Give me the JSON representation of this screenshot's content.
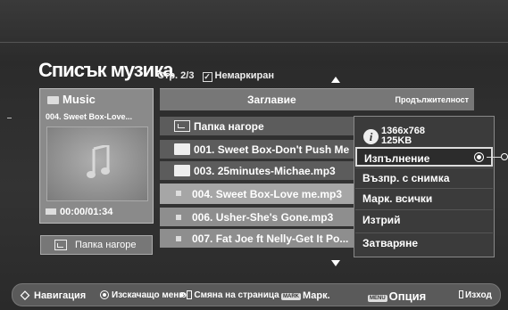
{
  "header": {
    "title": "Списък музика",
    "page_info": "Стр. 2/3",
    "unmarked_label": "Немаркиран"
  },
  "left_panel": {
    "folder_name": "Music",
    "current_track": "004. Sweet Box-Love...",
    "time": "00:00/01:34",
    "up_folder_button": "Папка нагоре"
  },
  "list": {
    "col_title": "Заглавие",
    "col_duration": "Продължителност",
    "rows": [
      {
        "label": "Папка нагоре",
        "type": "up"
      },
      {
        "label": "001. Sweet Box-Don't Push Me",
        "type": "folder"
      },
      {
        "label": "003. 25minutes-Michae.mp3",
        "type": "folder"
      },
      {
        "label": "004. Sweet Box-Love me.mp3",
        "type": "selected"
      },
      {
        "label": "006. Usher-She's Gone.mp3",
        "type": "file"
      },
      {
        "label": "007. Fat Joe ft Nelly-Get It Po...",
        "type": "file"
      }
    ]
  },
  "popup": {
    "resolution": "1366x768",
    "size": "125KB",
    "items": [
      {
        "label": "Изпълнение",
        "selected": true
      },
      {
        "label": "Възпр. с снимка"
      },
      {
        "label": "Марк. всички"
      },
      {
        "label": "Изтрий"
      },
      {
        "label": "Затваряне"
      }
    ]
  },
  "bottom_bar": {
    "navigation": "Навигация",
    "popup_menu": "Изскачащо меню",
    "page_key": "P",
    "page_change": "Смяна на страница",
    "mark_key": "MARK",
    "mark": "Марк.",
    "menu_key": "MENU",
    "option": "Опция",
    "exit": "Изход"
  },
  "colors": {
    "background": "#2e2e2e",
    "row_file": "#8e8e8e",
    "row_selected": "#a6a6a6",
    "popup": "#3b3b3b"
  }
}
